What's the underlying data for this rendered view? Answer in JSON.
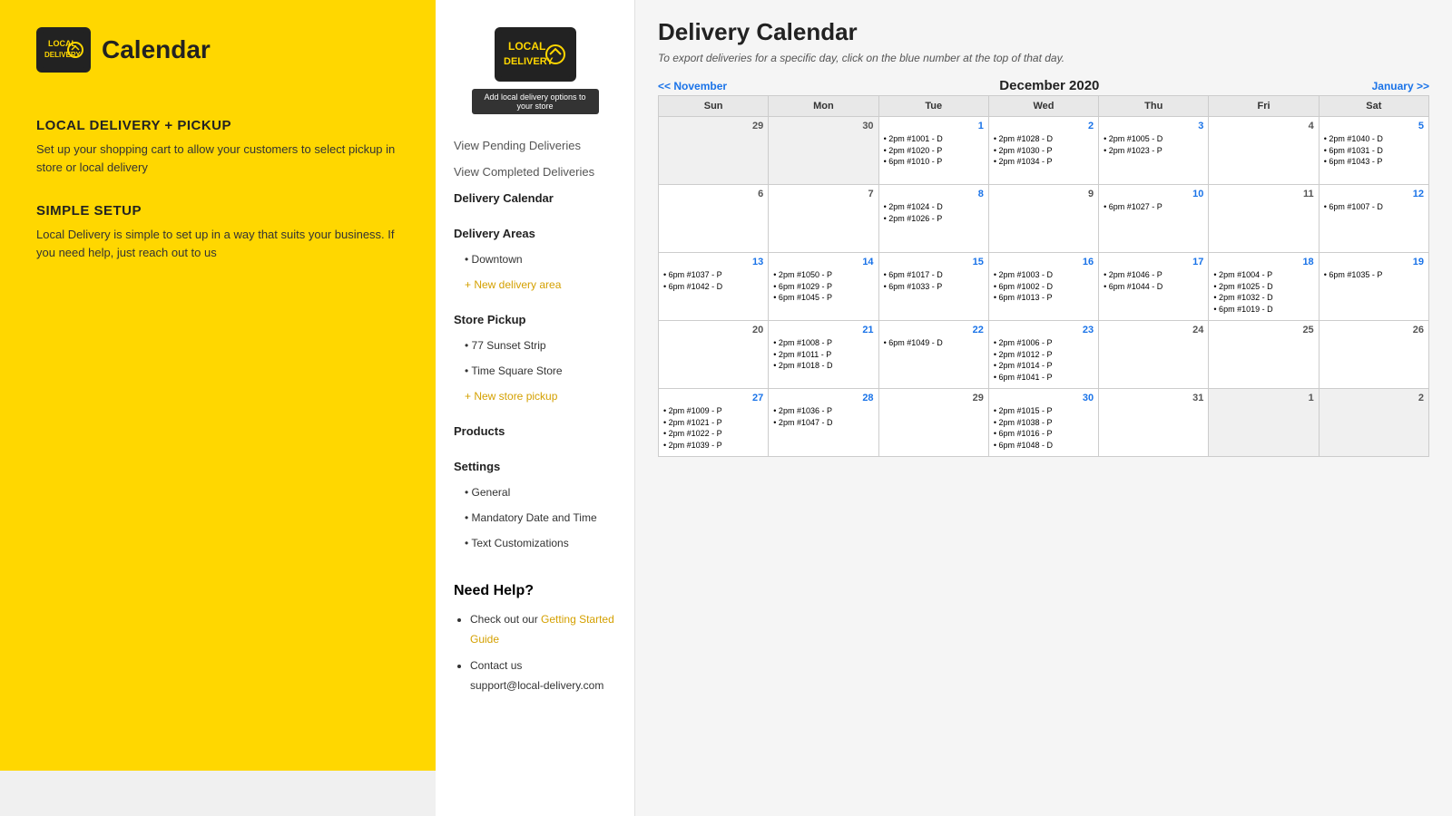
{
  "leftPanel": {
    "logo": {
      "line1": "LOCAL",
      "line2": "DELIVERY"
    },
    "title": "Calendar",
    "sections": [
      {
        "heading": "LOCAL DELIVERY + PICKUP",
        "text": "Set up your shopping cart to allow your customers to select pickup in store or local delivery"
      },
      {
        "heading": "SIMPLE SETUP",
        "text": "Local Delivery is simple to set up in a way that suits your business. If you need help, just reach out to us"
      }
    ]
  },
  "sidebar": {
    "logoLine1": "LOCAL",
    "logoLine2": "DELIVERY",
    "addButton": "Add local delivery options to your store",
    "nav": [
      {
        "label": "View Pending Deliveries",
        "type": "link"
      },
      {
        "label": "View Completed Deliveries",
        "type": "link"
      },
      {
        "label": "Delivery Calendar",
        "type": "active-link"
      },
      {
        "label": "Delivery Areas",
        "type": "section-header"
      },
      {
        "label": "Downtown",
        "type": "sub-item"
      },
      {
        "label": "+ New delivery area",
        "type": "sub-link"
      },
      {
        "label": "Store Pickup",
        "type": "section-header"
      },
      {
        "label": "77 Sunset Strip",
        "type": "sub-item"
      },
      {
        "label": "Time Square Store",
        "type": "sub-item"
      },
      {
        "label": "+ New store pickup",
        "type": "sub-link"
      },
      {
        "label": "Products",
        "type": "section-header"
      },
      {
        "label": "Settings",
        "type": "section-header"
      },
      {
        "label": "General",
        "type": "sub-item"
      },
      {
        "label": "Mandatory Date and Time",
        "type": "sub-item"
      },
      {
        "label": "Text Customizations",
        "type": "sub-item"
      }
    ],
    "needHelp": {
      "title": "Need Help?",
      "items": [
        {
          "text": "Check out our ",
          "link": "Getting Started Guide",
          "after": ""
        },
        {
          "text": "Contact us",
          "sub": "support@local-delivery.com"
        }
      ]
    }
  },
  "calendar": {
    "title": "Delivery Calendar",
    "subtitle": "To export deliveries for a specific day, click on the blue number at the top of that day.",
    "prevMonth": "<< November",
    "currentMonth": "December 2020",
    "nextMonth": "January >>",
    "weekdays": [
      "Sun",
      "Mon",
      "Tue",
      "Wed",
      "Thu",
      "Fri",
      "Sat"
    ],
    "weeks": [
      [
        {
          "num": "29",
          "grey": true,
          "items": []
        },
        {
          "num": "30",
          "grey": true,
          "items": []
        },
        {
          "num": "1",
          "blue": true,
          "items": [
            {
              "text": "• 2pm #1001 - D",
              "type": "D"
            },
            {
              "text": "• 2pm #1020 - P",
              "type": "P"
            },
            {
              "text": "• 6pm #1010 - P",
              "type": "P"
            }
          ]
        },
        {
          "num": "2",
          "blue": true,
          "items": [
            {
              "text": "• 2pm #1028 - D",
              "type": "D"
            },
            {
              "text": "• 2pm #1030 - P",
              "type": "P"
            },
            {
              "text": "• 2pm #1034 - P",
              "type": "P"
            }
          ]
        },
        {
          "num": "3",
          "blue": true,
          "items": [
            {
              "text": "• 2pm #1005 - D",
              "type": "D"
            },
            {
              "text": "• 2pm #1023 - P",
              "type": "P"
            }
          ]
        },
        {
          "num": "4",
          "items": []
        },
        {
          "num": "5",
          "blue": true,
          "items": [
            {
              "text": "• 2pm #1040 - D",
              "type": "D"
            },
            {
              "text": "• 6pm #1031 - D",
              "type": "D"
            },
            {
              "text": "• 6pm #1043 - P",
              "type": "P"
            }
          ]
        }
      ],
      [
        {
          "num": "6",
          "items": []
        },
        {
          "num": "7",
          "items": []
        },
        {
          "num": "8",
          "blue": true,
          "items": [
            {
              "text": "• 2pm #1024 - D",
              "type": "D"
            },
            {
              "text": "• 2pm #1026 - P",
              "type": "P"
            }
          ]
        },
        {
          "num": "9",
          "items": []
        },
        {
          "num": "10",
          "blue": true,
          "items": [
            {
              "text": "• 6pm #1027 - P",
              "type": "P"
            }
          ]
        },
        {
          "num": "11",
          "items": []
        },
        {
          "num": "12",
          "blue": true,
          "items": [
            {
              "text": "• 6pm #1007 - D",
              "type": "D"
            }
          ]
        }
      ],
      [
        {
          "num": "13",
          "blue": true,
          "items": [
            {
              "text": "• 6pm #1037 - P",
              "type": "P"
            },
            {
              "text": "• 6pm #1042 - D",
              "type": "D"
            }
          ]
        },
        {
          "num": "14",
          "blue": true,
          "items": [
            {
              "text": "• 2pm #1050 - P",
              "type": "P"
            },
            {
              "text": "• 6pm #1029 - P",
              "type": "P"
            },
            {
              "text": "• 6pm #1045 - P",
              "type": "P"
            }
          ]
        },
        {
          "num": "15",
          "blue": true,
          "items": [
            {
              "text": "• 6pm #1017 - D",
              "type": "D"
            },
            {
              "text": "• 6pm #1033 - P",
              "type": "P"
            }
          ]
        },
        {
          "num": "16",
          "blue": true,
          "items": [
            {
              "text": "• 2pm #1003 - D",
              "type": "D"
            },
            {
              "text": "• 6pm #1002 - D",
              "type": "D"
            },
            {
              "text": "• 6pm #1013 - P",
              "type": "P"
            }
          ]
        },
        {
          "num": "17",
          "blue": true,
          "items": [
            {
              "text": "• 2pm #1046 - P",
              "type": "P"
            },
            {
              "text": "• 6pm #1044 - D",
              "type": "D"
            }
          ]
        },
        {
          "num": "18",
          "blue": true,
          "items": [
            {
              "text": "• 2pm #1004 - P",
              "type": "P"
            },
            {
              "text": "• 2pm #1025 - D",
              "type": "D"
            },
            {
              "text": "• 2pm #1032 - D",
              "type": "D"
            },
            {
              "text": "• 6pm #1019 - D",
              "type": "D"
            }
          ]
        },
        {
          "num": "19",
          "blue": true,
          "items": [
            {
              "text": "• 6pm #1035 - P",
              "type": "P"
            }
          ]
        }
      ],
      [
        {
          "num": "20",
          "items": []
        },
        {
          "num": "21",
          "blue": true,
          "items": [
            {
              "text": "• 2pm #1008 - P",
              "type": "P"
            },
            {
              "text": "• 2pm #1011 - P",
              "type": "P"
            },
            {
              "text": "• 2pm #1018 - D",
              "type": "D"
            }
          ]
        },
        {
          "num": "22",
          "blue": true,
          "items": [
            {
              "text": "• 6pm #1049 - D",
              "type": "D"
            }
          ]
        },
        {
          "num": "23",
          "blue": true,
          "items": [
            {
              "text": "• 2pm #1006 - P",
              "type": "P"
            },
            {
              "text": "• 2pm #1012 - P",
              "type": "P"
            },
            {
              "text": "• 2pm #1014 - P",
              "type": "P"
            },
            {
              "text": "• 6pm #1041 - P",
              "type": "P"
            }
          ]
        },
        {
          "num": "24",
          "items": []
        },
        {
          "num": "25",
          "items": []
        },
        {
          "num": "26",
          "items": []
        }
      ],
      [
        {
          "num": "27",
          "blue": true,
          "items": [
            {
              "text": "• 2pm #1009 - P",
              "type": "P"
            },
            {
              "text": "• 2pm #1021 - P",
              "type": "P"
            },
            {
              "text": "• 2pm #1022 - P",
              "type": "P"
            },
            {
              "text": "• 2pm #1039 - P",
              "type": "P"
            }
          ]
        },
        {
          "num": "28",
          "blue": true,
          "items": [
            {
              "text": "• 2pm #1036 - P",
              "type": "P"
            },
            {
              "text": "• 2pm #1047 - D",
              "type": "D"
            }
          ]
        },
        {
          "num": "29",
          "items": []
        },
        {
          "num": "30",
          "blue": true,
          "items": [
            {
              "text": "• 2pm #1015 - P",
              "type": "P"
            },
            {
              "text": "• 2pm #1038 - P",
              "type": "P"
            },
            {
              "text": "• 6pm #1016 - P",
              "type": "P"
            },
            {
              "text": "• 6pm #1048 - D",
              "type": "D"
            }
          ]
        },
        {
          "num": "31",
          "items": []
        },
        {
          "num": "1",
          "grey": true,
          "items": []
        },
        {
          "num": "2",
          "grey": true,
          "items": []
        }
      ]
    ]
  }
}
